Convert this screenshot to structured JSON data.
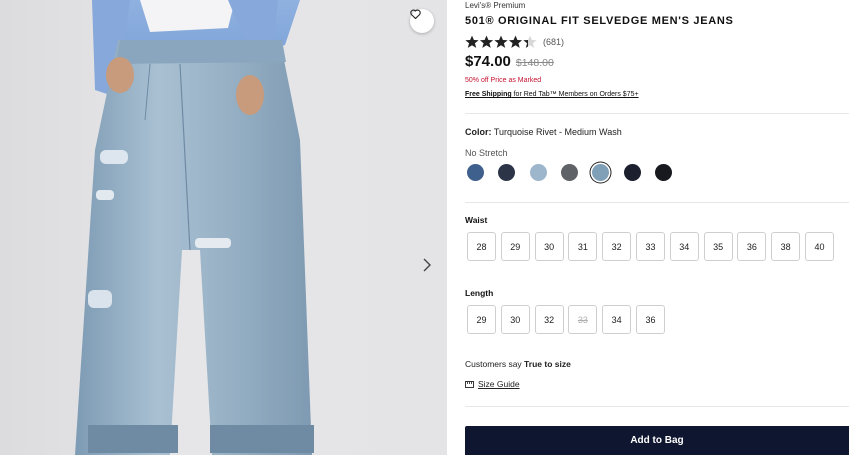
{
  "product": {
    "brand": "Levi's® Premium",
    "title": "501® ORIGINAL FIT SELVEDGE MEN'S JEANS",
    "rating": 4.5,
    "review_count": "(681)",
    "price": "$74.00",
    "original_price": "$148.00",
    "promo": "50% off Price as Marked",
    "shipping_link": "Free Shipping",
    "shipping_text": " for Red Tab™ Members on Orders $75+"
  },
  "color": {
    "label": "Color:",
    "value": "Turquoise Rivet - Medium Wash",
    "stretch": "No Stretch",
    "swatches": [
      {
        "name": "swatch-1",
        "color": "#3f5f8c"
      },
      {
        "name": "swatch-2",
        "color": "#2b3547"
      },
      {
        "name": "swatch-3",
        "color": "#9db6cc"
      },
      {
        "name": "swatch-4",
        "color": "#5f6266"
      },
      {
        "name": "swatch-5",
        "color": "#7fa0b6",
        "selected": true
      },
      {
        "name": "swatch-6",
        "color": "#1b1f2e"
      },
      {
        "name": "swatch-7",
        "color": "#17191f"
      }
    ]
  },
  "waist": {
    "label": "Waist",
    "sizes": [
      "28",
      "29",
      "30",
      "31",
      "32",
      "33",
      "34",
      "35",
      "36",
      "38",
      "40"
    ]
  },
  "length": {
    "label": "Length",
    "sizes": [
      {
        "value": "29",
        "available": true
      },
      {
        "value": "30",
        "available": true
      },
      {
        "value": "32",
        "available": true
      },
      {
        "value": "33",
        "available": false
      },
      {
        "value": "34",
        "available": true
      },
      {
        "value": "36",
        "available": true
      }
    ]
  },
  "fit": {
    "prefix": "Customers say ",
    "value": "True to size"
  },
  "size_guide": "Size Guide",
  "add_to_bag": "Add to Bag",
  "icons": {
    "wishlist": "heart-icon",
    "next": "chevron-right-icon",
    "ruler": "ruler-icon"
  }
}
